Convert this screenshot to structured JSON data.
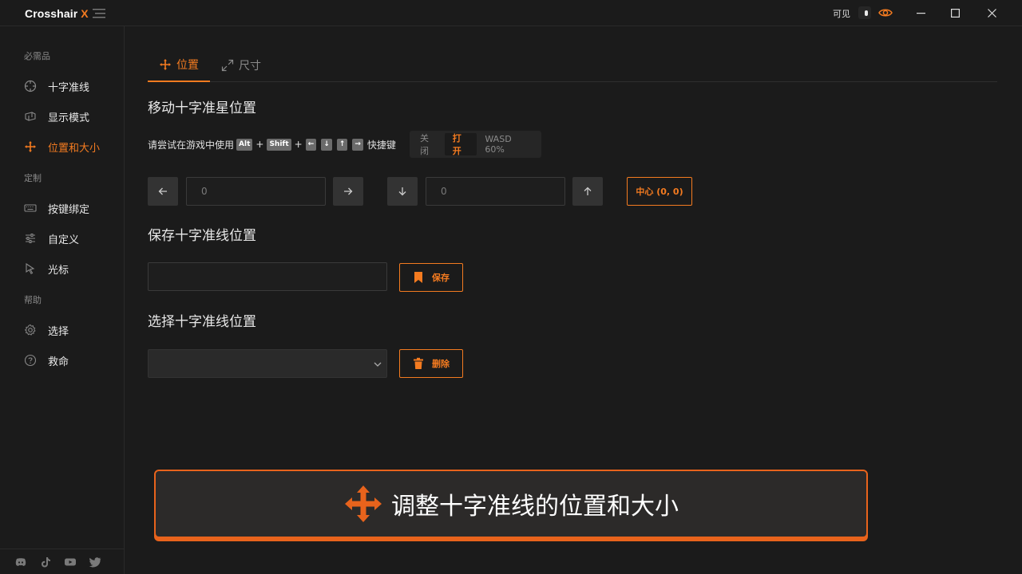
{
  "app": {
    "name": "Crosshair",
    "name_accent": "X"
  },
  "titlebar": {
    "visible_label": "可见"
  },
  "sidebar": {
    "sections": [
      "必需品",
      "定制",
      "帮助"
    ],
    "items": [
      {
        "label": "十字准线",
        "icon": "crosshair-icon"
      },
      {
        "label": "显示模式",
        "icon": "display-mode-icon"
      },
      {
        "label": "位置和大小",
        "icon": "move-icon",
        "active": true
      },
      {
        "label": "按键绑定",
        "icon": "keyboard-icon"
      },
      {
        "label": "自定义",
        "icon": "sliders-icon"
      },
      {
        "label": "光标",
        "icon": "cursor-icon"
      },
      {
        "label": "选择",
        "icon": "gear-icon"
      },
      {
        "label": "救命",
        "icon": "help-icon"
      }
    ],
    "socials": [
      "discord-icon",
      "tiktok-icon",
      "youtube-icon",
      "twitter-icon"
    ]
  },
  "tabs": [
    {
      "label": "位置",
      "active": true
    },
    {
      "label": "尺寸",
      "active": false
    }
  ],
  "move": {
    "title": "移动十字准星位置",
    "hint_prefix": "请尝试在游戏中使用",
    "keys": [
      "Alt",
      "Shift",
      "←",
      "↓",
      "↑",
      "→"
    ],
    "hint_suffix": "快捷键",
    "mode_options": [
      "关闭",
      "打开",
      "WASD 60%"
    ],
    "mode_selected": "打开",
    "x_value": "0",
    "y_value": "0",
    "center_label": "中心 (0, 0)"
  },
  "save": {
    "title": "保存十字准线位置",
    "input_value": "",
    "button_label": "保存"
  },
  "select": {
    "title": "选择十字准线位置",
    "selected": "",
    "delete_label": "删除"
  },
  "banner": {
    "text": "调整十字准线的位置和大小"
  },
  "colors": {
    "accent": "#f47b20",
    "background": "#1b1b1b",
    "banner_border": "#e8631c"
  }
}
